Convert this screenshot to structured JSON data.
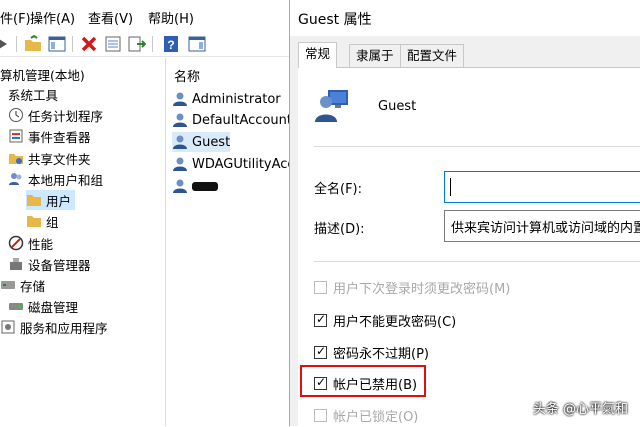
{
  "menubar": {
    "items": [
      "件(F)",
      "操作(A)",
      "查看(V)",
      "帮助(H)"
    ]
  },
  "tree": {
    "root": "算机管理(本地)",
    "items": [
      "系统工具",
      "任务计划程序",
      "事件查看器",
      "共享文件夹",
      "本地用户和组",
      "用户",
      "组",
      "性能",
      "设备管理器",
      "存储",
      "磁盘管理",
      "服务和应用程序"
    ]
  },
  "list": {
    "header": "名称",
    "items": [
      "Administrator",
      "DefaultAccount",
      "Guest",
      "WDAGUtilityAcc"
    ]
  },
  "dialog": {
    "title": "Guest 属性",
    "tabs": [
      "常规",
      "隶属于",
      "配置文件"
    ],
    "user_name": "Guest",
    "fullname_label": "全名(F):",
    "fullname_value": "",
    "desc_label": "描述(D):",
    "desc_value": "供来宾访问计算机或访问域的内置",
    "checkboxes": [
      {
        "label": "用户下次登录时须更改密码(M)",
        "checked": false,
        "disabled": true
      },
      {
        "label": "用户不能更改密码(C)",
        "checked": true,
        "disabled": false
      },
      {
        "label": "密码永不过期(P)",
        "checked": true,
        "disabled": false
      },
      {
        "label": "帐户已禁用(B)",
        "checked": true,
        "disabled": false
      },
      {
        "label": "帐户已锁定(O)",
        "checked": false,
        "disabled": true
      }
    ]
  },
  "watermark": "头条 @心平氣和",
  "colors": {
    "highlight": "#e01010",
    "selection": "#cce8ff"
  }
}
